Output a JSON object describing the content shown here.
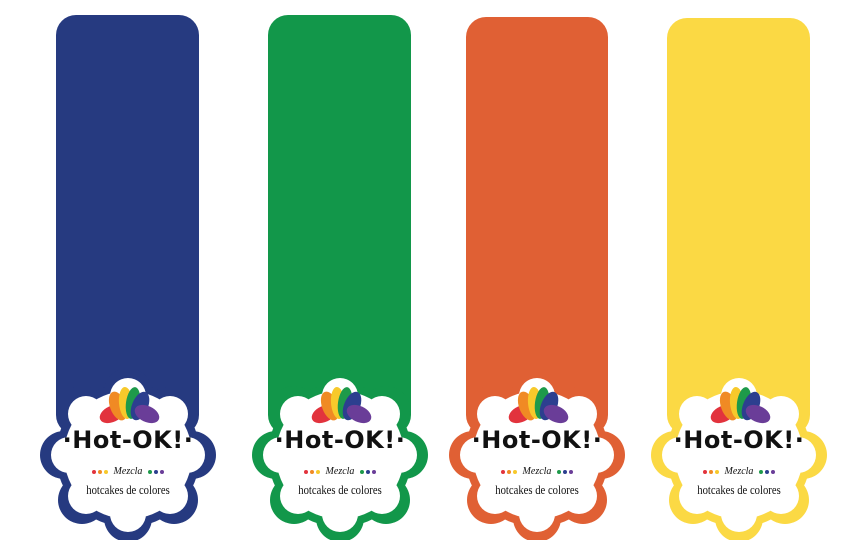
{
  "colors": {
    "navy": "#263a80",
    "green": "#12974a",
    "orange": "#e06034",
    "yellow": "#fbd944",
    "black": "#111111"
  },
  "brand_dot_colors": [
    "#e2333d",
    "#f08a24",
    "#f7c92b",
    "#1e9a4a",
    "#2c3f8f",
    "#6a3d98"
  ],
  "fan_colors": [
    "#e2333d",
    "#f08a24",
    "#f7c92b",
    "#1e9a4a",
    "#2c3f8f",
    "#6a3d98"
  ],
  "tags": [
    {
      "color": "#263a80",
      "logo": {
        "brand": "·Hot-OK!·",
        "flavor": "Mezcla",
        "tagline": "hotcakes de colores"
      }
    },
    {
      "color": "#12974a",
      "logo": {
        "brand": "·Hot-OK!·",
        "flavor": "Mezcla",
        "tagline": "hotcakes de colores"
      }
    },
    {
      "color": "#e06034",
      "logo": {
        "brand": "·Hot-OK!·",
        "flavor": "Mezcla",
        "tagline": "hotcakes de colores"
      }
    },
    {
      "color": "#fbd944",
      "logo": {
        "brand": "·Hot-OK!·",
        "flavor": "Mezcla",
        "tagline": "hotcakes de colores"
      }
    }
  ]
}
